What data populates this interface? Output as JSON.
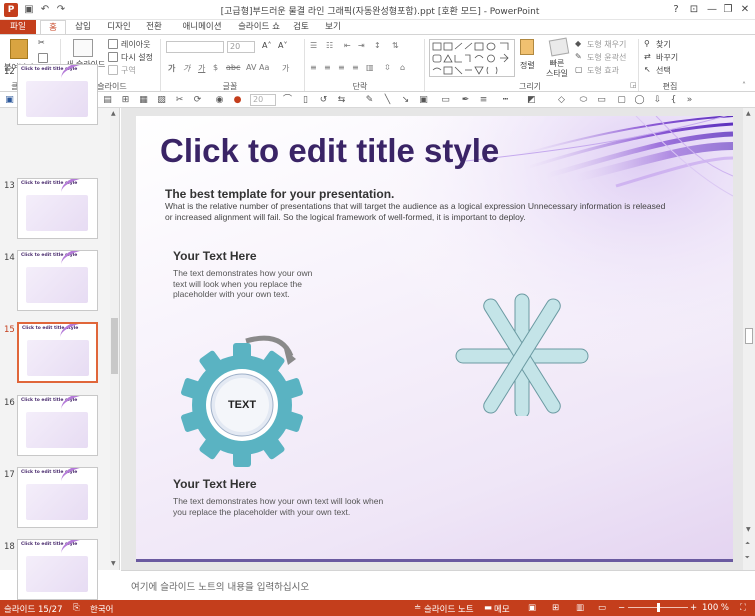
{
  "window": {
    "title": "[고급형]부드러운 물결 라인 그래픽(자동완성형포함).ppt [호환 모드] - PowerPoint",
    "help": "?",
    "minimize": "—",
    "restore": "❐",
    "close": "✕"
  },
  "tabs": [
    "파일",
    "홈",
    "삽입",
    "디자인",
    "전환",
    "애니메이션",
    "슬라이드 쇼",
    "검토",
    "보기"
  ],
  "ribbon": {
    "clipboard": {
      "paste": "붙여넣기",
      "label": "클립보드"
    },
    "slides": {
      "new_slide": "새 슬라이드",
      "layout": "레이아웃",
      "reset": "다시 설정",
      "section": "구역",
      "label": "슬라이드"
    },
    "font": {
      "size": "20",
      "label": "글꼴"
    },
    "paragraph": {
      "label": "단락"
    },
    "drawing": {
      "arrange": "정렬",
      "quick_styles": "빠른 스타일",
      "shape_fill": "도형 채우기",
      "shape_outline": "도형 윤곽선",
      "shape_effects": "도형 효과",
      "label": "그리기"
    },
    "editing": {
      "find": "찾기",
      "replace": "바꾸기",
      "select": "선택",
      "label": "편집"
    }
  },
  "toolbar2": {
    "font_size": "20"
  },
  "thumbnails": {
    "numbers": [
      "12",
      "13",
      "14",
      "15",
      "16",
      "17",
      "18"
    ],
    "selected": "15",
    "title_text": "Click to edit title style"
  },
  "slide": {
    "title": "Click to edit title style",
    "subtitle": "The best template for your presentation.",
    "body": "What is the relative number of presentations that will target the audience as a logical expression Unnecessary information is released or increased alignment will fail. So the logical framework of well-formed, it is important to deploy.",
    "heading1": "Your Text Here",
    "text1": "The text demonstrates how your own text will look when you replace the placeholder with your own text.",
    "gear_label": "TEXT",
    "heading2": "Your Text Here",
    "text2": "The text demonstrates how your own text will look when you replace the placeholder with your own text."
  },
  "notes": {
    "placeholder": "여기에 슬라이드 노트의 내용을 입력하십시오"
  },
  "status": {
    "slide_pos": "슬라이드 15/27",
    "language": "한국어",
    "notes_btn": "슬라이드 노트",
    "comments_btn": "메모",
    "zoom": "100 %",
    "zoom_level": 1.0
  },
  "colors": {
    "accent": "#c43e1c",
    "title": "#3a2466",
    "gear": "#5ab3c2",
    "asterisk": "#c4e4e8"
  }
}
